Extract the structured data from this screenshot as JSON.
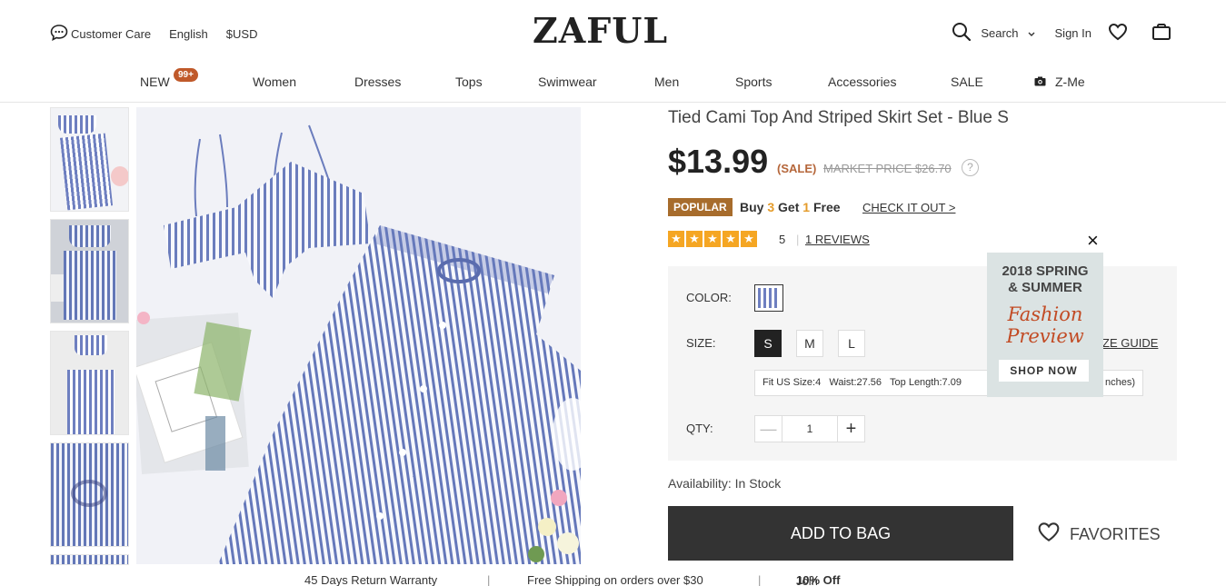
{
  "header": {
    "customer_care": "Customer Care",
    "language": "English",
    "currency": "$USD",
    "logo": "ZAFUL",
    "search": "Search",
    "sign_in": "Sign In"
  },
  "nav": {
    "items": [
      "NEW",
      "Women",
      "Dresses",
      "Tops",
      "Swimwear",
      "Men",
      "Sports",
      "Accessories",
      "SALE",
      "Z-Me"
    ],
    "new_badge": "99+"
  },
  "product": {
    "title": "Tied Cami Top And Striped Skirt Set - Blue S",
    "price": "$13.99",
    "sale_tag": "(SALE)",
    "market_price": "MARKET PRICE $26.70",
    "help": "?",
    "popular": "POPULAR",
    "promo": {
      "buy": "Buy",
      "buy_n": "3",
      "get": "Get",
      "get_n": "1",
      "free": "Free"
    },
    "check_it_out": "CHECK IT OUT >",
    "rating": "5",
    "rating_sep": "|",
    "reviews": "1 REVIEWS",
    "stars": 5,
    "color_label": "COLOR:",
    "size_label": "SIZE:",
    "sizes": [
      "S",
      "M",
      "L"
    ],
    "selected_size": "S",
    "size_guide": "ZE GUIDE",
    "fit": {
      "us": "Fit US Size:4",
      "waist": "Waist:27.56",
      "top": "Top Length:7.09",
      "unit": "nches)"
    },
    "qty_label": "QTY:",
    "qty": {
      "minus": "—",
      "value": "1",
      "plus": "+"
    },
    "availability": "Availability: In Stock",
    "add_to_bag": "ADD TO BAG",
    "favorites": "FAVORITES"
  },
  "ad": {
    "line1": "2018 SPRING",
    "line2": "& SUMMER",
    "line3": "Fashion",
    "line4": "Preview",
    "cta": "SHOP NOW",
    "close": "×"
  },
  "footer": {
    "return": "45 Days Return Warranty",
    "sep": "|",
    "shipping": "Free Shipping on orders over $30",
    "join": "Join and Get",
    "off": "10% Off"
  },
  "colors": {
    "accent": "#a76c2c",
    "sale": "#b5663a",
    "star": "#f5a623",
    "stripe": "#6e7fc0"
  }
}
